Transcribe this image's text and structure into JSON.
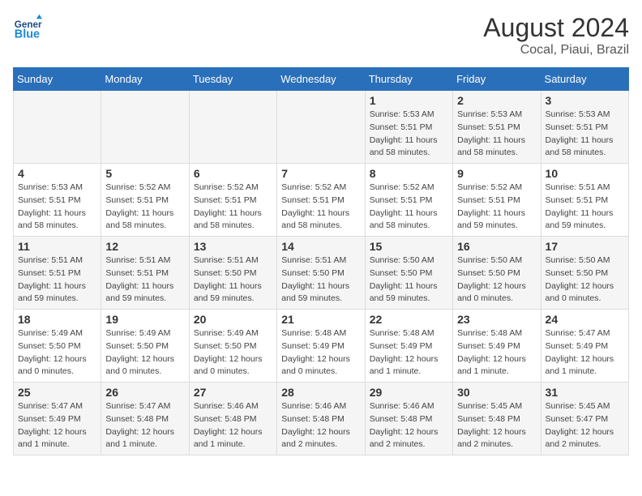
{
  "header": {
    "logo_general": "General",
    "logo_blue": "Blue",
    "month_year": "August 2024",
    "location": "Cocal, Piaui, Brazil"
  },
  "days_of_week": [
    "Sunday",
    "Monday",
    "Tuesday",
    "Wednesday",
    "Thursday",
    "Friday",
    "Saturday"
  ],
  "weeks": [
    [
      {
        "day": "",
        "info": ""
      },
      {
        "day": "",
        "info": ""
      },
      {
        "day": "",
        "info": ""
      },
      {
        "day": "",
        "info": ""
      },
      {
        "day": "1",
        "info": "Sunrise: 5:53 AM\nSunset: 5:51 PM\nDaylight: 11 hours\nand 58 minutes."
      },
      {
        "day": "2",
        "info": "Sunrise: 5:53 AM\nSunset: 5:51 PM\nDaylight: 11 hours\nand 58 minutes."
      },
      {
        "day": "3",
        "info": "Sunrise: 5:53 AM\nSunset: 5:51 PM\nDaylight: 11 hours\nand 58 minutes."
      }
    ],
    [
      {
        "day": "4",
        "info": "Sunrise: 5:53 AM\nSunset: 5:51 PM\nDaylight: 11 hours\nand 58 minutes."
      },
      {
        "day": "5",
        "info": "Sunrise: 5:52 AM\nSunset: 5:51 PM\nDaylight: 11 hours\nand 58 minutes."
      },
      {
        "day": "6",
        "info": "Sunrise: 5:52 AM\nSunset: 5:51 PM\nDaylight: 11 hours\nand 58 minutes."
      },
      {
        "day": "7",
        "info": "Sunrise: 5:52 AM\nSunset: 5:51 PM\nDaylight: 11 hours\nand 58 minutes."
      },
      {
        "day": "8",
        "info": "Sunrise: 5:52 AM\nSunset: 5:51 PM\nDaylight: 11 hours\nand 58 minutes."
      },
      {
        "day": "9",
        "info": "Sunrise: 5:52 AM\nSunset: 5:51 PM\nDaylight: 11 hours\nand 59 minutes."
      },
      {
        "day": "10",
        "info": "Sunrise: 5:51 AM\nSunset: 5:51 PM\nDaylight: 11 hours\nand 59 minutes."
      }
    ],
    [
      {
        "day": "11",
        "info": "Sunrise: 5:51 AM\nSunset: 5:51 PM\nDaylight: 11 hours\nand 59 minutes."
      },
      {
        "day": "12",
        "info": "Sunrise: 5:51 AM\nSunset: 5:51 PM\nDaylight: 11 hours\nand 59 minutes."
      },
      {
        "day": "13",
        "info": "Sunrise: 5:51 AM\nSunset: 5:50 PM\nDaylight: 11 hours\nand 59 minutes."
      },
      {
        "day": "14",
        "info": "Sunrise: 5:51 AM\nSunset: 5:50 PM\nDaylight: 11 hours\nand 59 minutes."
      },
      {
        "day": "15",
        "info": "Sunrise: 5:50 AM\nSunset: 5:50 PM\nDaylight: 11 hours\nand 59 minutes."
      },
      {
        "day": "16",
        "info": "Sunrise: 5:50 AM\nSunset: 5:50 PM\nDaylight: 12 hours\nand 0 minutes."
      },
      {
        "day": "17",
        "info": "Sunrise: 5:50 AM\nSunset: 5:50 PM\nDaylight: 12 hours\nand 0 minutes."
      }
    ],
    [
      {
        "day": "18",
        "info": "Sunrise: 5:49 AM\nSunset: 5:50 PM\nDaylight: 12 hours\nand 0 minutes."
      },
      {
        "day": "19",
        "info": "Sunrise: 5:49 AM\nSunset: 5:50 PM\nDaylight: 12 hours\nand 0 minutes."
      },
      {
        "day": "20",
        "info": "Sunrise: 5:49 AM\nSunset: 5:50 PM\nDaylight: 12 hours\nand 0 minutes."
      },
      {
        "day": "21",
        "info": "Sunrise: 5:48 AM\nSunset: 5:49 PM\nDaylight: 12 hours\nand 0 minutes."
      },
      {
        "day": "22",
        "info": "Sunrise: 5:48 AM\nSunset: 5:49 PM\nDaylight: 12 hours\nand 1 minute."
      },
      {
        "day": "23",
        "info": "Sunrise: 5:48 AM\nSunset: 5:49 PM\nDaylight: 12 hours\nand 1 minute."
      },
      {
        "day": "24",
        "info": "Sunrise: 5:47 AM\nSunset: 5:49 PM\nDaylight: 12 hours\nand 1 minute."
      }
    ],
    [
      {
        "day": "25",
        "info": "Sunrise: 5:47 AM\nSunset: 5:49 PM\nDaylight: 12 hours\nand 1 minute."
      },
      {
        "day": "26",
        "info": "Sunrise: 5:47 AM\nSunset: 5:48 PM\nDaylight: 12 hours\nand 1 minute."
      },
      {
        "day": "27",
        "info": "Sunrise: 5:46 AM\nSunset: 5:48 PM\nDaylight: 12 hours\nand 1 minute."
      },
      {
        "day": "28",
        "info": "Sunrise: 5:46 AM\nSunset: 5:48 PM\nDaylight: 12 hours\nand 2 minutes."
      },
      {
        "day": "29",
        "info": "Sunrise: 5:46 AM\nSunset: 5:48 PM\nDaylight: 12 hours\nand 2 minutes."
      },
      {
        "day": "30",
        "info": "Sunrise: 5:45 AM\nSunset: 5:48 PM\nDaylight: 12 hours\nand 2 minutes."
      },
      {
        "day": "31",
        "info": "Sunrise: 5:45 AM\nSunset: 5:47 PM\nDaylight: 12 hours\nand 2 minutes."
      }
    ]
  ]
}
